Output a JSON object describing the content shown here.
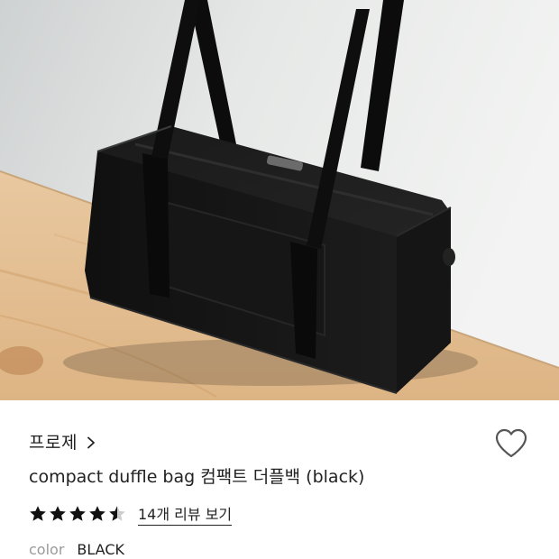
{
  "product": {
    "image_alt": "compact duffle bag black",
    "brand": "프로제",
    "title": "compact duffle bag 컴팩트 더플백 (black)",
    "rating": 4.5,
    "rating_max": 5,
    "review_link": "14개 리뷰 보기",
    "option_label": "color",
    "option_value": "BLACK"
  },
  "icons": {
    "brand_chevron": "chevron-right-icon",
    "wishlist": "heart-outline-icon",
    "star_full": "star-filled-icon",
    "star_half": "star-half-icon"
  },
  "colors": {
    "text": "#222222",
    "muted": "#9a9a9a",
    "star": "#111111",
    "star_empty": "#cccccc"
  }
}
